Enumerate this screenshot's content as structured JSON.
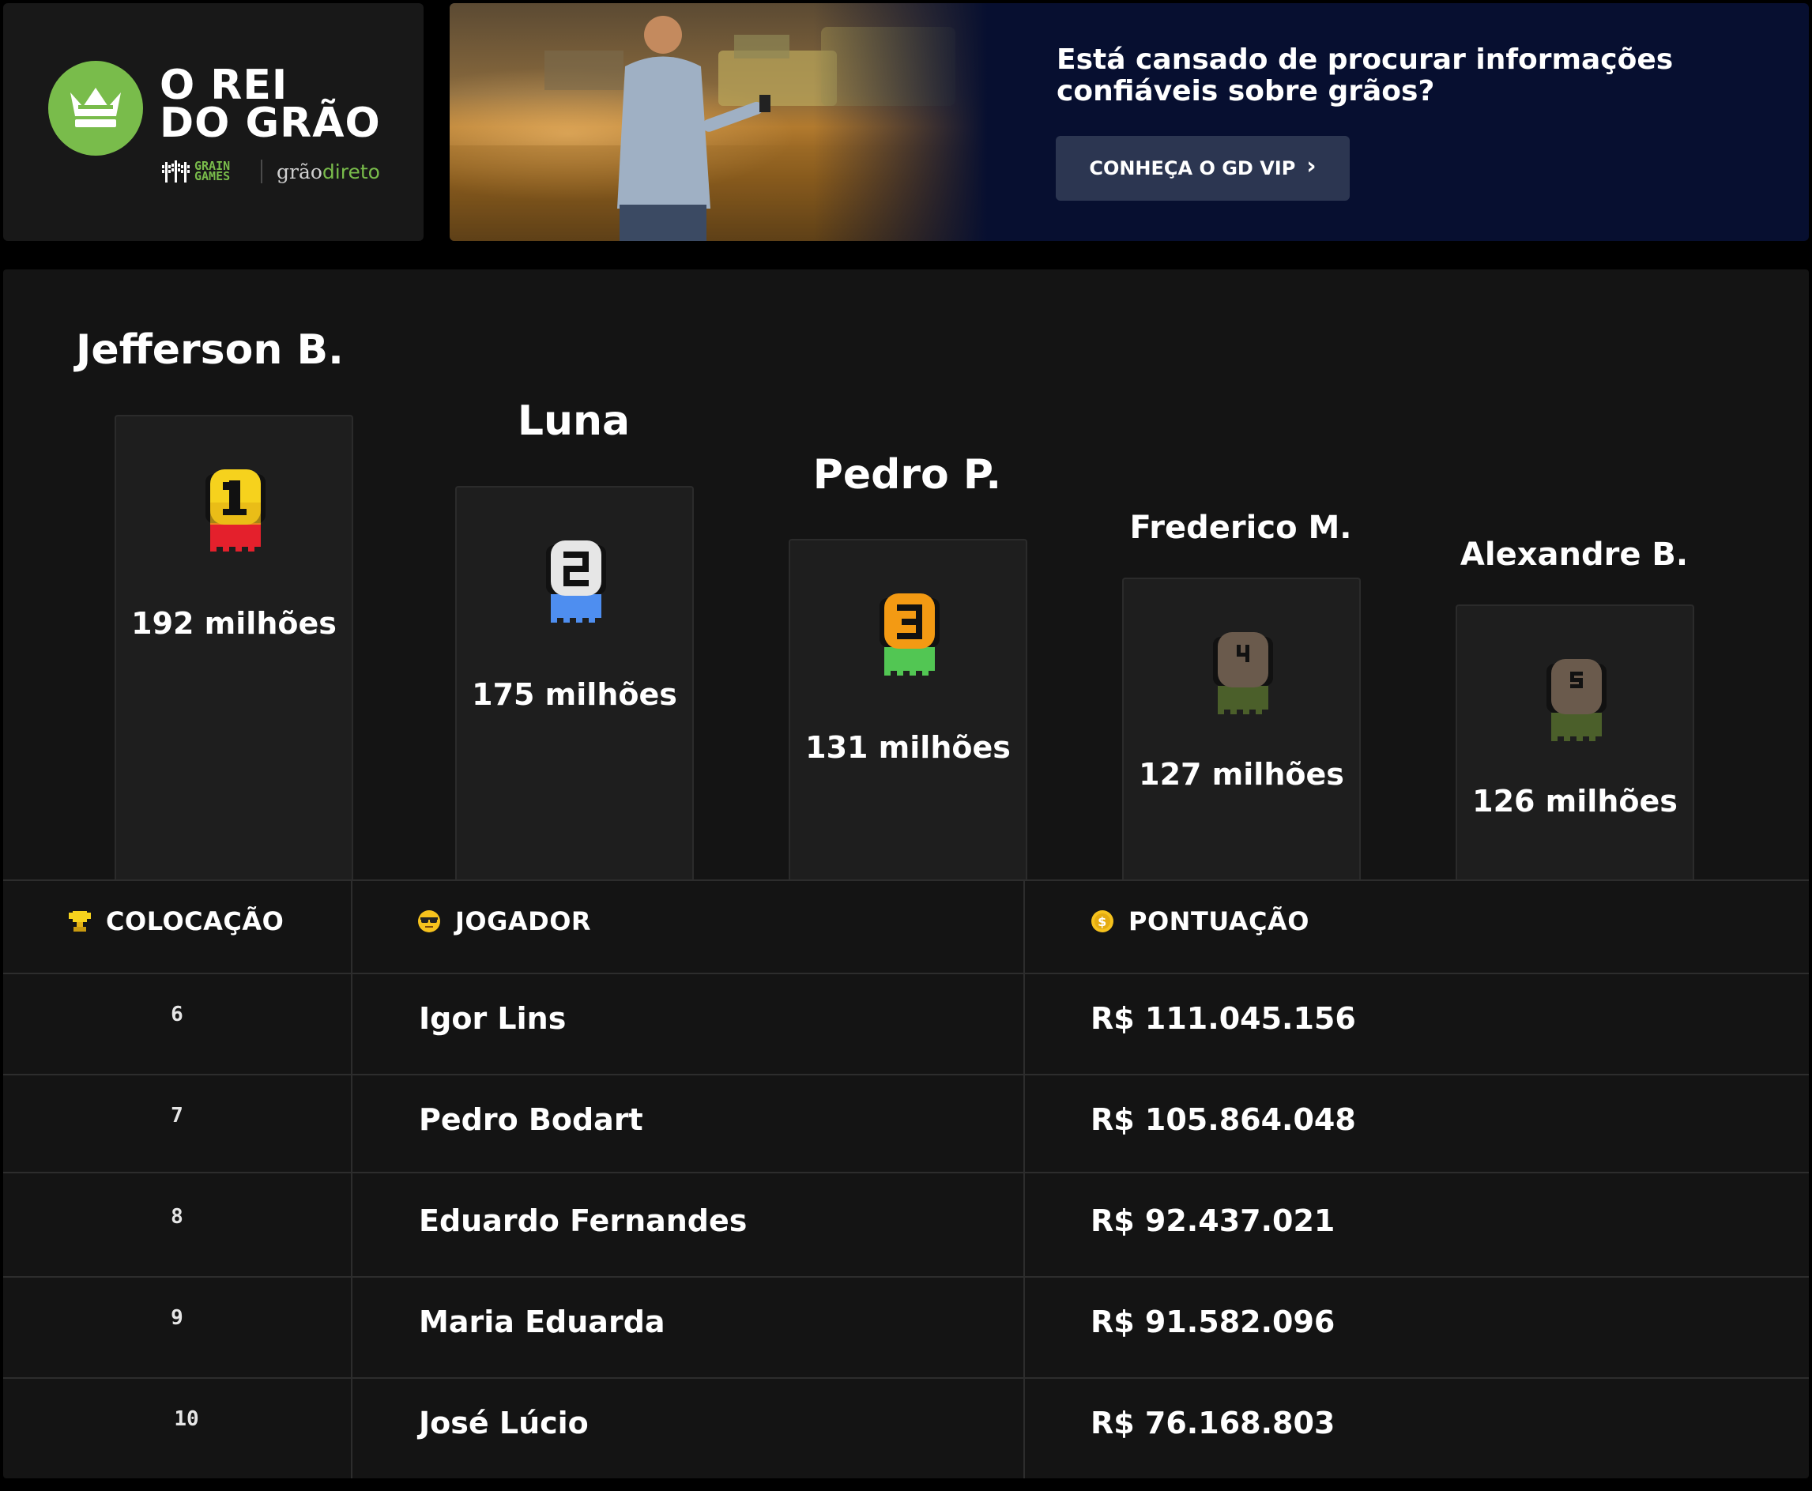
{
  "header": {
    "logo": {
      "title_line1": "O REI",
      "title_line2": "DO GRÃO",
      "brand_grain_games": "GRAIN\nGAMES",
      "brand_grao": "grão",
      "brand_direto": "direto",
      "accent_color": "#79bc4b"
    },
    "banner": {
      "heading": "Está cansado de procurar informações confiáveis sobre grãos?",
      "cta_label": "CONHEÇA O GD VIP",
      "cta_icon": "chevron-right-icon",
      "background_color": "#070f30"
    }
  },
  "podium": [
    {
      "rank": 1,
      "name": "Jefferson B.",
      "score": "192 milhões",
      "medal_color": "#f6d21d",
      "ribbon_color": "#e4202c",
      "medal_icon": "medal-1-icon"
    },
    {
      "rank": 2,
      "name": "Luna",
      "score": "175 milhões",
      "medal_color": "#e6e6e6",
      "ribbon_color": "#4e8ef0",
      "medal_icon": "medal-2-icon"
    },
    {
      "rank": 3,
      "name": "Pedro P.",
      "score": "131 milhões",
      "medal_color": "#f39a13",
      "ribbon_color": "#52c653",
      "medal_icon": "medal-3-icon"
    },
    {
      "rank": 4,
      "name": "Frederico M.",
      "score": "127 milhões",
      "medal_color": "#6a5a4c",
      "ribbon_color": "#4b5f2a",
      "medal_icon": "medal-4-icon"
    },
    {
      "rank": 5,
      "name": "Alexandre B.",
      "score": "126 milhões",
      "medal_color": "#6a5a4c",
      "ribbon_color": "#4b5f2a",
      "medal_icon": "medal-5-icon"
    }
  ],
  "table": {
    "headers": {
      "placement": "COLOCAÇÃO",
      "player": "JOGADOR",
      "score": "PONTUAÇÃO",
      "placement_icon": "trophy-icon",
      "player_icon": "sunglasses-face-icon",
      "score_icon": "coin-icon"
    },
    "rows": [
      {
        "rank": "6",
        "name": "Igor Lins",
        "score": "R$ 111.045.156"
      },
      {
        "rank": "7",
        "name": "Pedro Bodart",
        "score": "R$ 105.864.048"
      },
      {
        "rank": "8",
        "name": "Eduardo Fernandes",
        "score": "R$ 92.437.021"
      },
      {
        "rank": "9",
        "name": "Maria Eduarda",
        "score": "R$ 91.582.096"
      },
      {
        "rank": "10",
        "name": "José Lúcio",
        "score": "R$ 76.168.803"
      }
    ]
  }
}
